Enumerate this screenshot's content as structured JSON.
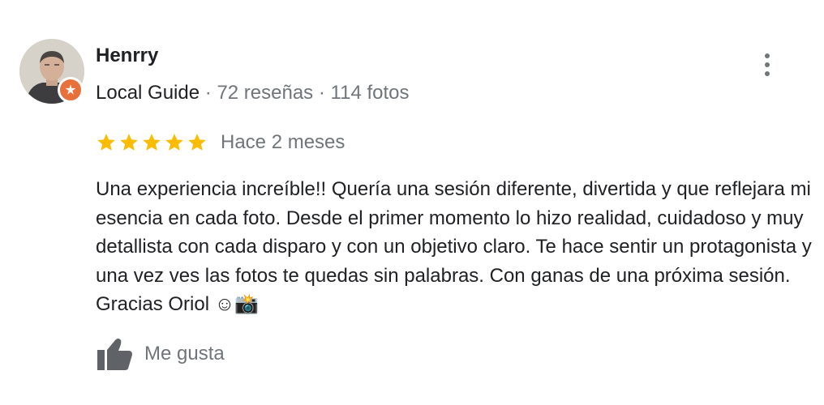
{
  "review": {
    "author": {
      "name": "Henrry",
      "badge_label": "Local Guide",
      "separator": "·",
      "reviews_count": "72 reseñas",
      "photos_count": "114 fotos"
    },
    "rating": 5,
    "rating_max": 5,
    "date": "Hace 2 meses",
    "text": "Una experiencia increíble!! Quería una sesión diferente, divertida y que reflejara mi esencia en cada foto. Desde el primer momento lo hizo realidad, cuidadoso y muy detallista con cada disparo y con un objetivo claro. Te hace sentir un protagonista y una vez ves las fotos te quedas sin palabras. Con ganas de una próxima sesión. Gracias Oriol ☺📸",
    "like_label": "Me gusta"
  },
  "icons": {
    "menu": "more-vert-icon",
    "star": "star-icon",
    "like": "thumb-up-icon",
    "badge": "local-guide-icon"
  },
  "colors": {
    "star": "#fbbc04",
    "badge": "#e8703a",
    "primary_text": "#202124",
    "secondary_text": "#70757a"
  }
}
